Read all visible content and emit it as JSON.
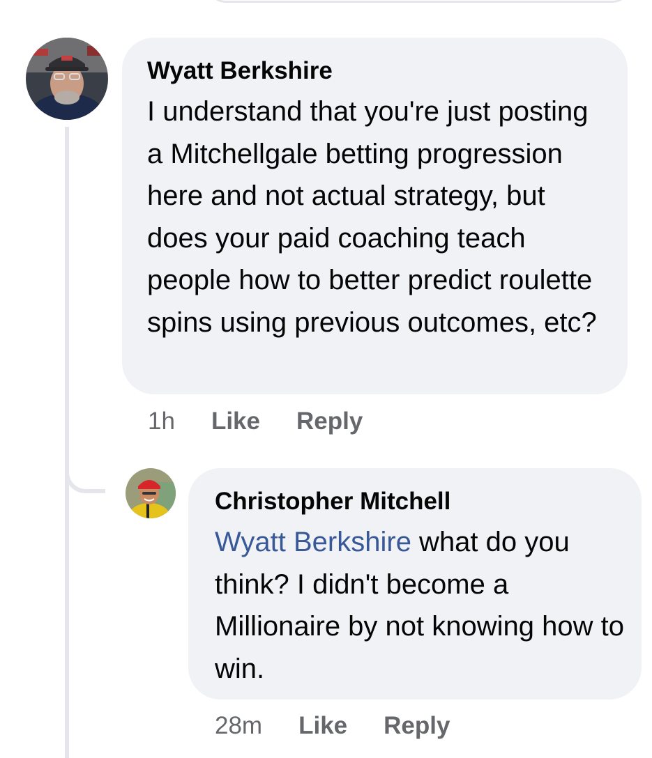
{
  "comments": [
    {
      "author": "Wyatt Berkshire",
      "text": "I understand that you're just posting a Mitchellgale betting progression here and not actual strategy, but does your paid coaching teach people how to better predict roulette spins using previous outcomes, etc?",
      "time": "1h",
      "like_label": "Like",
      "reply_label": "Reply"
    },
    {
      "author": "Christopher Mitchell",
      "mention": "Wyatt Berkshire",
      "text": " what do you think? I didn't become a Millionaire by not knowing how to win.",
      "time": "28m",
      "like_label": "Like",
      "reply_label": "Reply"
    }
  ],
  "colors": {
    "bubble": "#f0f2f5",
    "mention": "#385898",
    "meta": "#65676b",
    "thread_line": "#e4e6eb"
  }
}
